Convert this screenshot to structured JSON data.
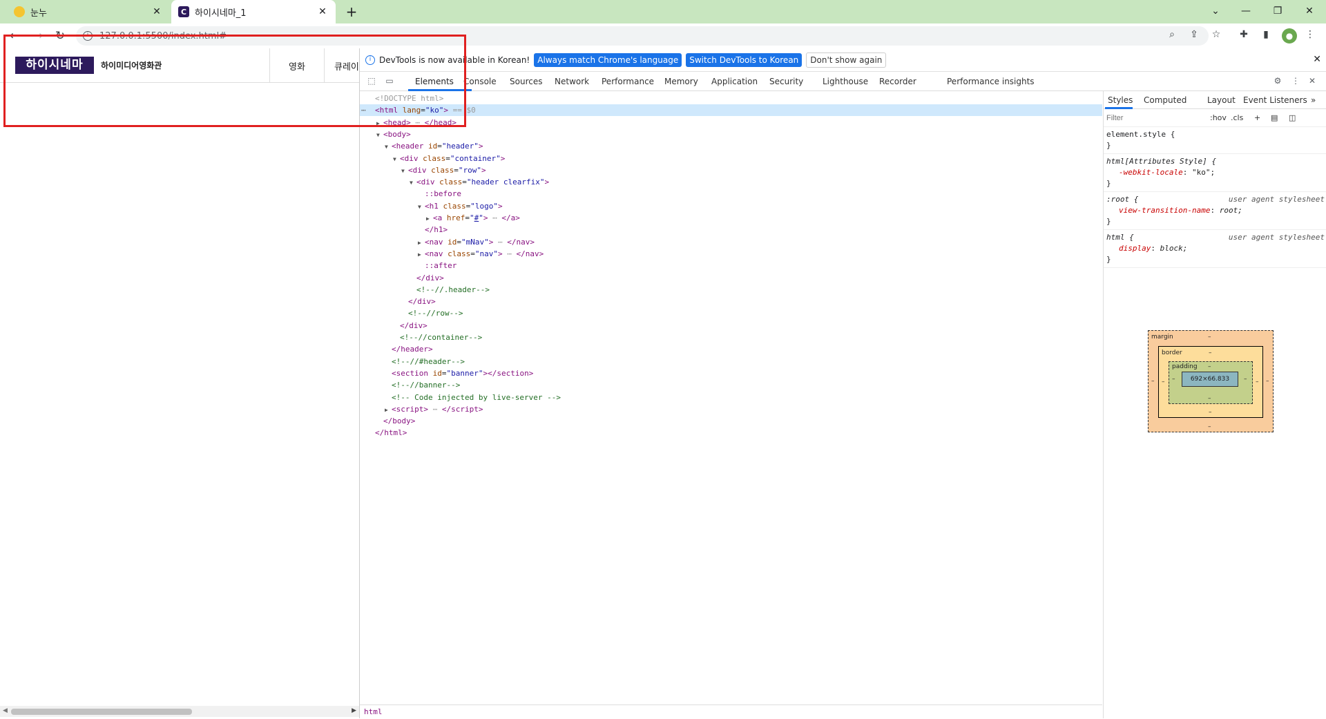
{
  "browser": {
    "tabs": [
      {
        "title": "눈누"
      },
      {
        "title": "하이시네마_1"
      }
    ],
    "favicon2": "C",
    "url": "127.0.0.1:5500/index.html#",
    "avatar": "●"
  },
  "site": {
    "logo": "하이시네마",
    "logo_sub": "하이미디어영화관",
    "menu": [
      "영화",
      "큐레이"
    ]
  },
  "devtools": {
    "info_text": "DevTools is now available in Korean!",
    "btn_match": "Always match Chrome's language",
    "btn_switch": "Switch DevTools to Korean",
    "btn_dismiss": "Don't show again",
    "tabs": [
      "Elements",
      "Console",
      "Sources",
      "Network",
      "Performance",
      "Memory",
      "Application",
      "Security",
      "Lighthouse",
      "Recorder",
      "Performance insights"
    ],
    "breadcrumb": "html",
    "dom": [
      {
        "indent": 1,
        "arrow": "",
        "html": "<span class='gray'>&lt;!DOCTYPE html&gt;</span>"
      },
      {
        "indent": 1,
        "arrow": "",
        "html": "<span class='tag'>&lt;html</span> <span class='attr'>lang</span>=<span class='val'>\"ko\"</span><span class='tag'>&gt;</span> <span class='gray'>== $0</span>",
        "sel": true
      },
      {
        "indent": 2,
        "arrow": "▶",
        "html": "<span class='tag'>&lt;head&gt;</span><span class='gray'> ⋯ </span><span class='tag'>&lt;/head&gt;</span>"
      },
      {
        "indent": 2,
        "arrow": "▼",
        "html": "<span class='tag'>&lt;body&gt;</span>"
      },
      {
        "indent": 3,
        "arrow": "▼",
        "html": "<span class='tag'>&lt;header</span> <span class='attr'>id</span>=<span class='val'>\"header\"</span><span class='tag'>&gt;</span>"
      },
      {
        "indent": 4,
        "arrow": "▼",
        "html": "<span class='tag'>&lt;div</span> <span class='attr'>class</span>=<span class='val'>\"container\"</span><span class='tag'>&gt;</span>"
      },
      {
        "indent": 5,
        "arrow": "▼",
        "html": "<span class='tag'>&lt;div</span> <span class='attr'>class</span>=<span class='val'>\"row\"</span><span class='tag'>&gt;</span>"
      },
      {
        "indent": 6,
        "arrow": "▼",
        "html": "<span class='tag'>&lt;div</span> <span class='attr'>class</span>=<span class='val'>\"header clearfix\"</span><span class='tag'>&gt;</span>"
      },
      {
        "indent": 7,
        "arrow": "",
        "html": "<span class='pseudo'>::before</span>"
      },
      {
        "indent": 7,
        "arrow": "▼",
        "html": "<span class='tag'>&lt;h1</span> <span class='attr'>class</span>=<span class='val'>\"logo\"</span><span class='tag'>&gt;</span>"
      },
      {
        "indent": 8,
        "arrow": "▶",
        "html": "<span class='tag'>&lt;a</span> <span class='attr'>href</span>=<span class='val'>\"<u>#</u>\"</span><span class='tag'>&gt;</span><span class='gray'> ⋯ </span><span class='tag'>&lt;/a&gt;</span>"
      },
      {
        "indent": 7,
        "arrow": "",
        "html": "<span class='tag'>&lt;/h1&gt;</span>"
      },
      {
        "indent": 7,
        "arrow": "▶",
        "html": "<span class='tag'>&lt;nav</span> <span class='attr'>id</span>=<span class='val'>\"mNav\"</span><span class='tag'>&gt;</span><span class='gray'> ⋯ </span><span class='tag'>&lt;/nav&gt;</span>"
      },
      {
        "indent": 7,
        "arrow": "▶",
        "html": "<span class='tag'>&lt;nav</span> <span class='attr'>class</span>=<span class='val'>\"nav\"</span><span class='tag'>&gt;</span><span class='gray'> ⋯ </span><span class='tag'>&lt;/nav&gt;</span>"
      },
      {
        "indent": 7,
        "arrow": "",
        "html": "<span class='pseudo'>::after</span>"
      },
      {
        "indent": 6,
        "arrow": "",
        "html": "<span class='tag'>&lt;/div&gt;</span>"
      },
      {
        "indent": 6,
        "arrow": "",
        "html": "<span class='cmt'>&lt;!--//.header--&gt;</span>"
      },
      {
        "indent": 5,
        "arrow": "",
        "html": "<span class='tag'>&lt;/div&gt;</span>"
      },
      {
        "indent": 5,
        "arrow": "",
        "html": "<span class='cmt'>&lt;!--//row--&gt;</span>"
      },
      {
        "indent": 4,
        "arrow": "",
        "html": "<span class='tag'>&lt;/div&gt;</span>"
      },
      {
        "indent": 4,
        "arrow": "",
        "html": "<span class='cmt'>&lt;!--//container--&gt;</span>"
      },
      {
        "indent": 3,
        "arrow": "",
        "html": "<span class='tag'>&lt;/header&gt;</span>"
      },
      {
        "indent": 3,
        "arrow": "",
        "html": "<span class='cmt'>&lt;!--//#header--&gt;</span>"
      },
      {
        "indent": 3,
        "arrow": "",
        "html": "<span class='tag'>&lt;section</span> <span class='attr'>id</span>=<span class='val'>\"banner\"</span><span class='tag'>&gt;&lt;/section&gt;</span>"
      },
      {
        "indent": 3,
        "arrow": "",
        "html": "<span class='cmt'>&lt;!--//banner--&gt;</span>"
      },
      {
        "indent": 3,
        "arrow": "",
        "html": "<span class='cmt'>&lt;!-- Code injected by live-server --&gt;</span>"
      },
      {
        "indent": 3,
        "arrow": "▶",
        "html": "<span class='tag'>&lt;script&gt;</span><span class='gray'> ⋯ </span><span class='tag'>&lt;/script&gt;</span>"
      },
      {
        "indent": 2,
        "arrow": "",
        "html": "<span class='tag'>&lt;/body&gt;</span>"
      },
      {
        "indent": 1,
        "arrow": "",
        "html": "<span class='tag'>&lt;/html&gt;</span>"
      }
    ],
    "styles": {
      "tabs": [
        "Styles",
        "Computed",
        "Layout",
        "Event Listeners"
      ],
      "filter_placeholder": "Filter",
      "hov": ":hov",
      "cls": ".cls",
      "rules": [
        {
          "selector": "element.style {",
          "source": "",
          "props": [],
          "close": "}"
        },
        {
          "selector": "html[Attributes Style] {",
          "source": "",
          "props": [
            {
              "name": "-webkit-locale",
              "value": "\"ko\";"
            }
          ],
          "close": "}"
        },
        {
          "selector": ":root {",
          "source": "user agent stylesheet",
          "props": [
            {
              "name": "view-transition-name",
              "value": "root;"
            }
          ],
          "close": "}"
        },
        {
          "selector": "html {",
          "source": "user agent stylesheet",
          "props": [
            {
              "name": "display",
              "value": "block;"
            }
          ],
          "close": "}"
        }
      ],
      "boxmodel": {
        "margin_label": "margin",
        "border_label": "border",
        "padding_label": "padding",
        "dash": "–",
        "content": "692×66.833"
      }
    }
  }
}
